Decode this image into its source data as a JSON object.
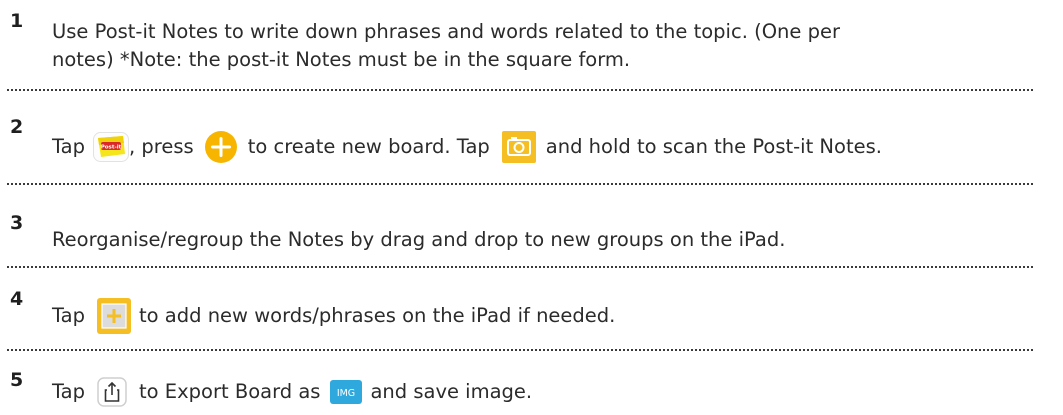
{
  "steps": [
    {
      "number": "1",
      "line1": "Use Post-it Notes to write down phrases and words related to the topic. (One per",
      "line2": "notes)  *Note: the post-it Notes must be in the square form."
    },
    {
      "number": "2",
      "part1": "Tap",
      "part2": ",  press",
      "part3": "to create new board. Tap",
      "part4": "and hold to scan the Post-it Notes.",
      "icons": [
        "post-it-app-icon",
        "plus-circle-icon",
        "camera-icon"
      ]
    },
    {
      "number": "3",
      "line1": "Reorganise/regroup the Notes by drag and drop to new groups on the iPad."
    },
    {
      "number": "4",
      "part1": "Tap",
      "part2": "to add new words/phrases on the iPad if needed.",
      "icons": [
        "add-note-icon"
      ]
    },
    {
      "number": "5",
      "part1": "Tap",
      "part2": "to Export Board as",
      "part3": "and save image.",
      "img_badge": "IMG",
      "icons": [
        "share-icon",
        "img-badge-icon"
      ]
    }
  ],
  "postit_logo_text": "Post-it",
  "colors": {
    "text": "#2b2b2b",
    "accent_yellow": "#f7b500",
    "camera_bg": "#f5be22",
    "img_badge": "#2fa8de",
    "divider": "#3a3a3a"
  }
}
